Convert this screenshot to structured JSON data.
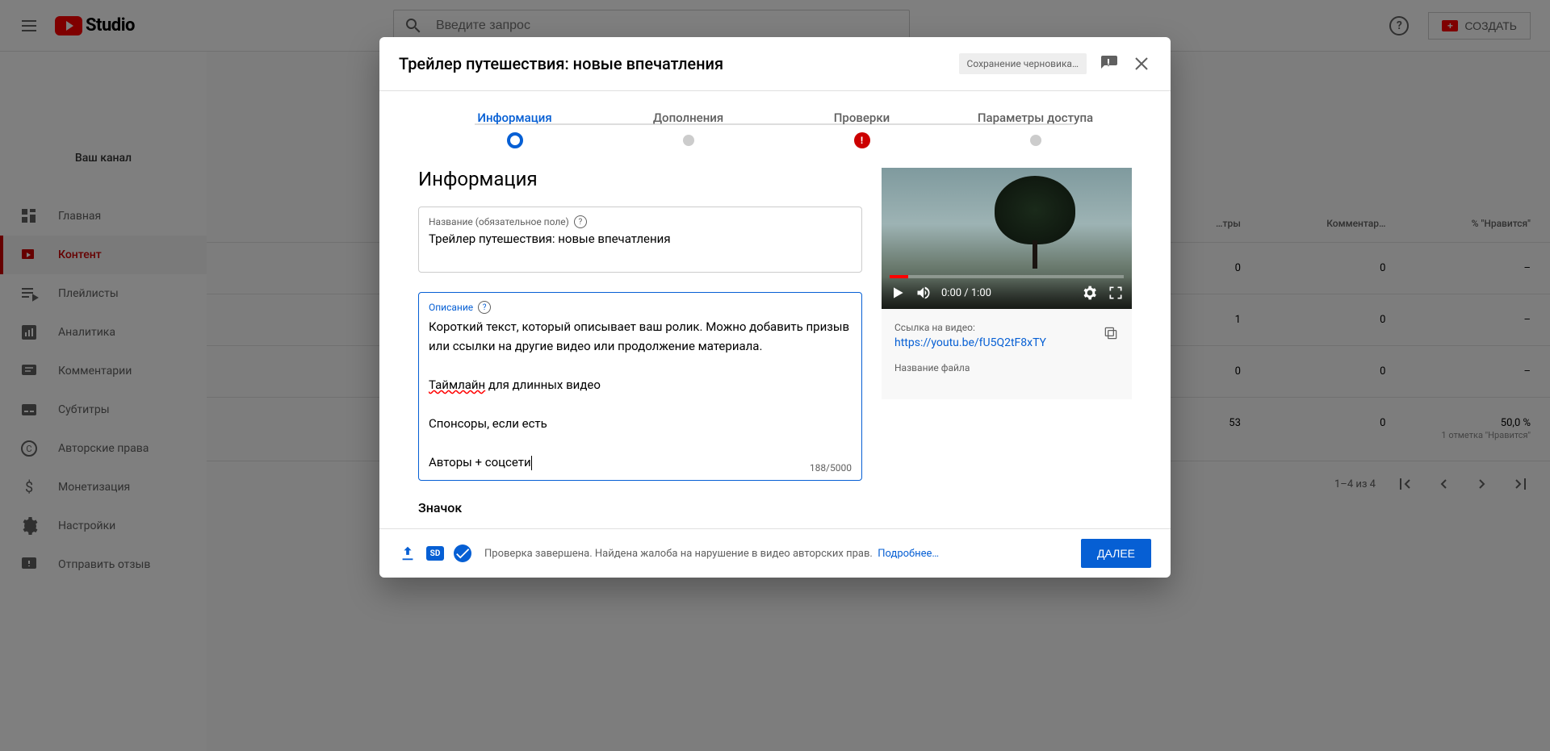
{
  "header": {
    "logo": "Studio",
    "search_placeholder": "Введите запрос",
    "create_button": "СОЗДАТЬ"
  },
  "sidebar": {
    "channel_label": "Ваш канал",
    "items": [
      {
        "label": "Главная",
        "icon": "dashboard"
      },
      {
        "label": "Контент",
        "icon": "content"
      },
      {
        "label": "Плейлисты",
        "icon": "playlist"
      },
      {
        "label": "Аналитика",
        "icon": "analytics"
      },
      {
        "label": "Комментарии",
        "icon": "comments"
      },
      {
        "label": "Субтитры",
        "icon": "subtitles"
      },
      {
        "label": "Авторские права",
        "icon": "copyright"
      },
      {
        "label": "Монетизация",
        "icon": "money"
      },
      {
        "label": "Настройки",
        "icon": "settings"
      },
      {
        "label": "Отправить отзыв",
        "icon": "feedback"
      }
    ]
  },
  "background_table": {
    "columns": [
      "…тры",
      "Комментар…",
      "% \"Нравится\""
    ],
    "rows": [
      {
        "views": "0",
        "comments": "0",
        "likes": "–"
      },
      {
        "views": "1",
        "comments": "0",
        "likes": "–"
      },
      {
        "views": "0",
        "comments": "0",
        "likes": "–"
      },
      {
        "views": "53",
        "comments": "0",
        "likes": "50,0 %",
        "likes_sub": "1 отметка \"Нравится\""
      }
    ],
    "pagination": "1–4 из 4"
  },
  "modal": {
    "title": "Трейлер путешествия: новые впечатления",
    "draft_status": "Сохранение черновика…",
    "steps": [
      {
        "label": "Информация",
        "state": "active"
      },
      {
        "label": "Дополнения",
        "state": "pending"
      },
      {
        "label": "Проверки",
        "state": "error"
      },
      {
        "label": "Параметры доступа",
        "state": "pending"
      }
    ],
    "section_title": "Информация",
    "title_field": {
      "label": "Название (обязательное поле)",
      "value": "Трейлер путешествия: новые впечатления"
    },
    "description_field": {
      "label": "Описание",
      "value": "Короткий текст, который описывает ваш ролик. Можно добавить призыв или ссылки на другие видео или продолжение материала.\n\nТаймлайн для длинных видео\n\nСпонсоры, если есть\n\nАвторы + соцсети",
      "counter": "188/5000",
      "spellcheck_word": "Таймлайн",
      "line1": "Короткий текст, который описывает ваш ролик. Можно добавить призыв или ссылки на другие видео или продолжение материала.",
      "line2_rest": " для длинных видео",
      "line3": "Спонсоры, если есть",
      "line4": "Авторы + соцсети"
    },
    "thumbnail_section": "Значок",
    "preview": {
      "time": "0:00 / 1:00",
      "link_label": "Ссылка на видео:",
      "link": "https://youtu.be/fU5Q2tF8xTY",
      "filename_label": "Название файла"
    },
    "footer": {
      "status": "Проверка завершена. Найдена жалоба на нарушение в видео авторских прав.",
      "more_link": "Подробнее…",
      "next_button": "ДАЛЕЕ"
    }
  }
}
